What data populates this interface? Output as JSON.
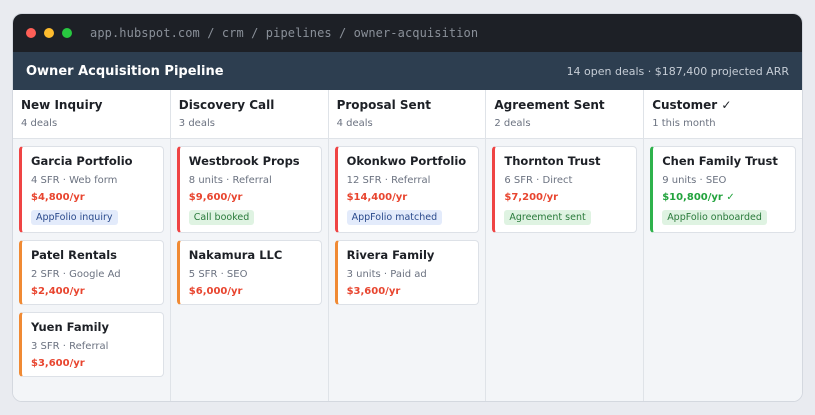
{
  "browser": {
    "url": "app.hubspot.com / crm / pipelines / owner-acquisition"
  },
  "header": {
    "title": "Owner Acquisition Pipeline",
    "summary": "14 open deals · $187,400 projected ARR"
  },
  "columns": [
    {
      "title": "New Inquiry",
      "count": "4 deals",
      "cards": [
        {
          "name": "Garcia Portfolio",
          "meta": "4 SFR · Web form",
          "value": "$4,800/yr",
          "badge": "AppFolio inquiry"
        },
        {
          "name": "Patel Rentals",
          "meta": "2 SFR · Google Ad",
          "value": "$2,400/yr"
        },
        {
          "name": "Yuen Family",
          "meta": "3 SFR · Referral",
          "value": "$3,600/yr"
        }
      ]
    },
    {
      "title": "Discovery Call",
      "count": "3 deals",
      "cards": [
        {
          "name": "Westbrook Props",
          "meta": "8 units · Referral",
          "value": "$9,600/yr",
          "badge": "Call booked"
        },
        {
          "name": "Nakamura LLC",
          "meta": "5 SFR · SEO",
          "value": "$6,000/yr"
        }
      ]
    },
    {
      "title": "Proposal Sent",
      "count": "4 deals",
      "cards": [
        {
          "name": "Okonkwo Portfolio",
          "meta": "12 SFR · Referral",
          "value": "$14,400/yr",
          "badge": "AppFolio matched"
        },
        {
          "name": "Rivera Family",
          "meta": "3 units · Paid ad",
          "value": "$3,600/yr"
        }
      ]
    },
    {
      "title": "Agreement Sent",
      "count": "2 deals",
      "cards": [
        {
          "name": "Thornton Trust",
          "meta": "6 SFR · Direct",
          "value": "$7,200/yr",
          "badge": "Agreement sent"
        }
      ]
    },
    {
      "title": "Customer ✓",
      "count": "1 this month",
      "cards": [
        {
          "name": "Chen Family Trust",
          "meta": "9 units · SEO",
          "value": "$10,800/yr ✓",
          "badge": "AppFolio onboarded"
        }
      ]
    }
  ]
}
